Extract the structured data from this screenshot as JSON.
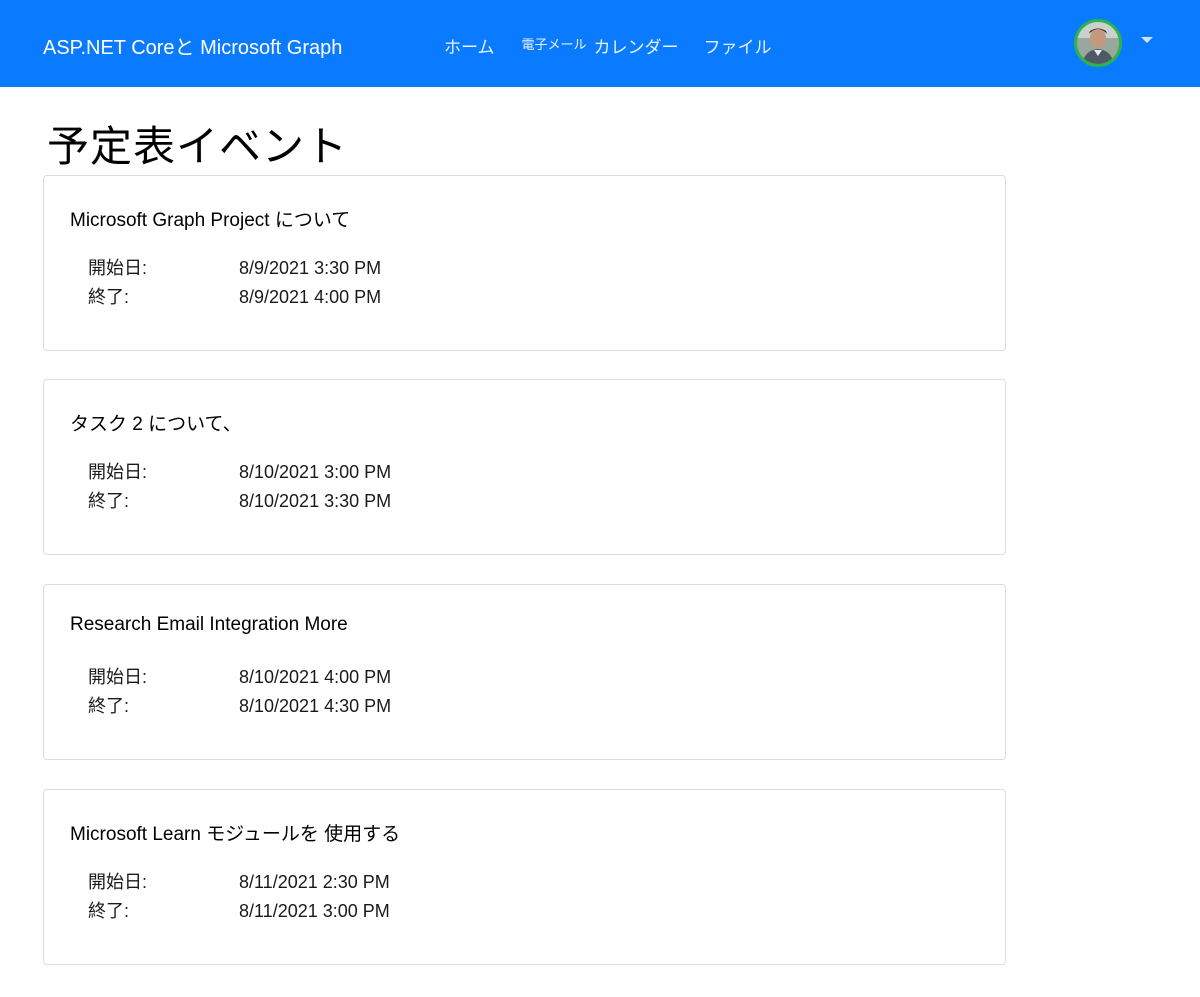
{
  "header": {
    "brand": "ASP.NET  Coreと Microsoft Graph",
    "nav": {
      "home": "ホーム",
      "mail": "電子メール",
      "calendar": "カレンダー",
      "files": "ファイル"
    },
    "avatar_icon": "user-avatar",
    "dropdown_icon": "caret-down-icon",
    "colors": {
      "navbar": "#0a7bfe",
      "avatar_ring": "#2db34a"
    }
  },
  "page": {
    "title": "予定表イベント"
  },
  "events": [
    {
      "subject": "Microsoft Graph Project について",
      "start_label": "開始日:",
      "start": "8/9/2021 3:30 PM",
      "end_label": "終了:",
      "end": "8/9/2021 4:00 PM"
    },
    {
      "subject": "タスク 2 について、",
      "start_label": "開始日:",
      "start": "8/10/2021 3:00 PM",
      "end_label": "終了:",
      "end": "8/10/2021 3:30 PM"
    },
    {
      "subject": "Research Email Integration More",
      "start_label": "開始日:",
      "start": "8/10/2021 4:00 PM",
      "end_label": "終了:",
      "end": "8/10/2021 4:30 PM"
    },
    {
      "subject": "Microsoft Learn モジュールを 使用する",
      "start_label": "開始日:",
      "start": "8/11/2021 2:30 PM",
      "end_label": "終了:",
      "end": "8/11/2021 3:00 PM"
    }
  ]
}
